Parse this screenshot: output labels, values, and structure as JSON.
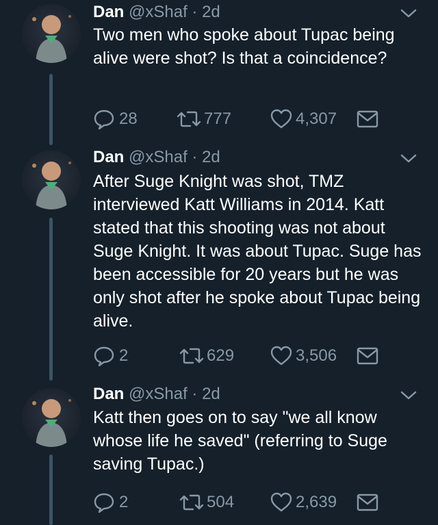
{
  "tweets": [
    {
      "name": "Dan",
      "handle": "@xShaf",
      "time": "· 2d",
      "text": "Two men who spoke about Tupac being alive were shot? Is that a coincidence?",
      "replies": "28",
      "retweets": "777",
      "likes": "4,307"
    },
    {
      "name": "Dan",
      "handle": "@xShaf",
      "time": "· 2d",
      "text": "After Suge Knight was shot, TMZ interviewed Katt Williams in 2014. Katt stated that this shooting was not about Suge Knight. It was about Tupac. Suge has been accessible for 20 years but he was only shot after he spoke about Tupac being alive.",
      "replies": "2",
      "retweets": "629",
      "likes": "3,506"
    },
    {
      "name": "Dan",
      "handle": "@xShaf",
      "time": "· 2d",
      "text": "Katt then goes on to say \"we all know whose life he saved\" (referring to Suge saving Tupac.)",
      "replies": "2",
      "retweets": "504",
      "likes": "2,639"
    }
  ],
  "icons": {
    "reply": "reply-icon",
    "retweet": "retweet-icon",
    "like": "heart-icon",
    "message": "envelope-icon",
    "caret": "chevron-down-icon"
  },
  "colors": {
    "background": "#15202b",
    "secondary_text": "#8899a6",
    "thread_line": "#3d5466"
  }
}
